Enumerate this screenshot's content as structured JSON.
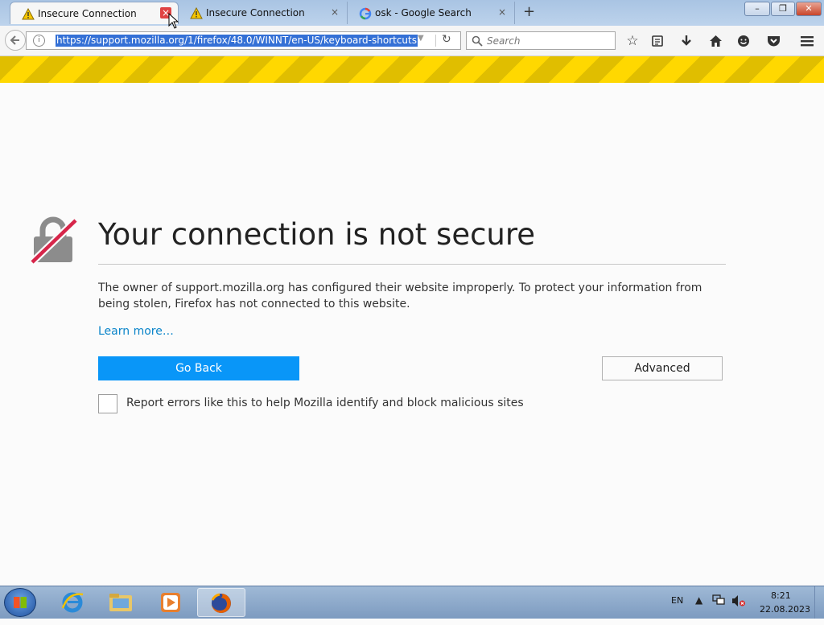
{
  "tabs": [
    {
      "title": "Insecure Connection",
      "icon": "warning-icon",
      "active": true
    },
    {
      "title": "Insecure Connection",
      "icon": "warning-icon",
      "active": false
    },
    {
      "title": "osk - Google Search",
      "icon": "google-icon",
      "active": false
    }
  ],
  "tab_close_glyph": "×",
  "new_tab_glyph": "+",
  "window": {
    "minimize": "–",
    "maximize": "❐",
    "close": "✕"
  },
  "navbar": {
    "url": "https://support.mozilla.org/1/firefox/48.0/WINNT/en-US/keyboard-shortcuts",
    "search_placeholder": "Search"
  },
  "page": {
    "title": "Your connection is not secure",
    "description": "The owner of support.mozilla.org has configured their website improperly. To protect your information from being stolen, Firefox has not connected to this website.",
    "learn_more": "Learn more…",
    "go_back": "Go Back",
    "advanced": "Advanced",
    "report_label": "Report errors like this to help Mozilla identify and block malicious sites",
    "report_checked": false
  },
  "taskbar": {
    "apps": [
      "internet-explorer-icon",
      "file-explorer-icon",
      "media-player-icon",
      "firefox-icon"
    ],
    "language": "EN",
    "time": "8:21",
    "date": "22.08.2023"
  },
  "colors": {
    "accent": "#0996f8",
    "link": "#0a84c9",
    "stripe_yellow": "#ffd800",
    "url_selection": "#3470d6"
  }
}
